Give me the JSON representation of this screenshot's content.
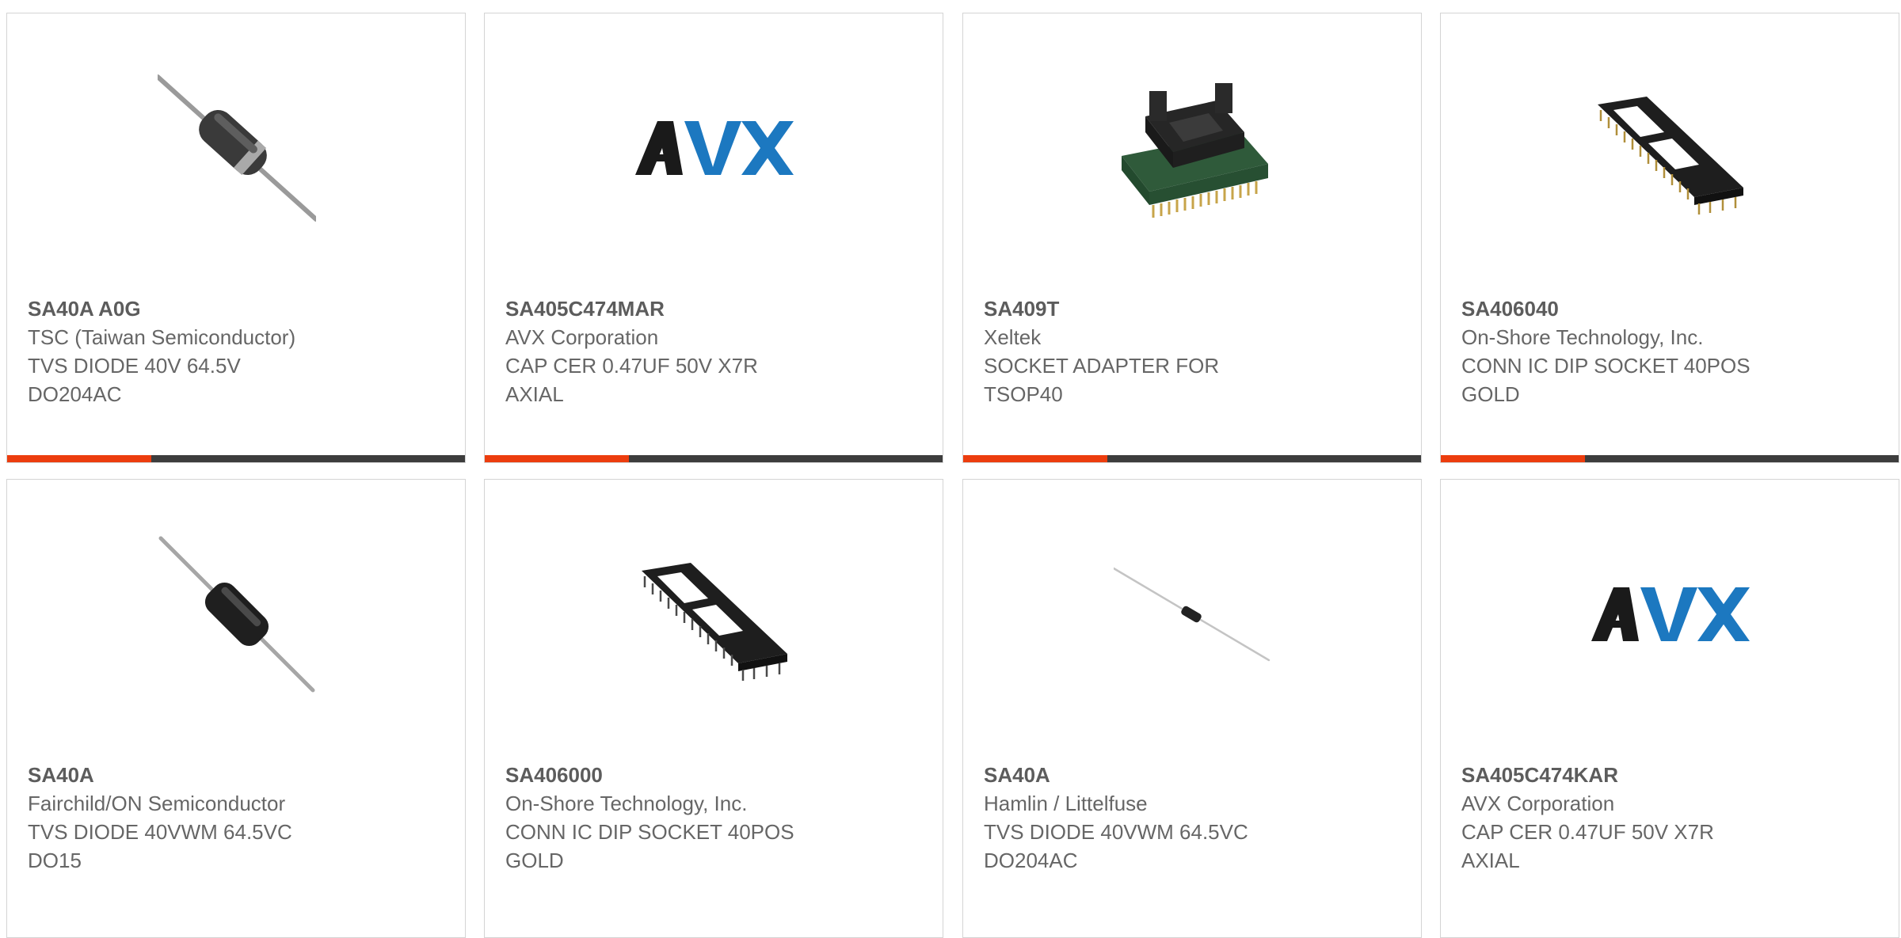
{
  "colors": {
    "accent": "#ec3d0e",
    "bar_dark": "#3d3d3d",
    "avx_blue": "#1c78c0",
    "avx_black": "#1a1a1a"
  },
  "products": [
    {
      "part_number": "SA40A A0G",
      "manufacturer": "TSC (Taiwan Semiconductor)",
      "desc_line1": "TVS DIODE 40V 64.5V",
      "desc_line2": "DO204AC",
      "image": "axial-diode-image"
    },
    {
      "part_number": "SA405C474MAR",
      "manufacturer": "AVX Corporation",
      "desc_line1": "CAP CER 0.47UF 50V X7R",
      "desc_line2": "AXIAL",
      "image": "avx-logo"
    },
    {
      "part_number": "SA409T",
      "manufacturer": "Xeltek",
      "desc_line1": "SOCKET ADAPTER FOR",
      "desc_line2": "TSOP40",
      "image": "socket-adapter-image"
    },
    {
      "part_number": "SA406040",
      "manufacturer": "On-Shore Technology, Inc.",
      "desc_line1": "CONN IC DIP SOCKET 40POS",
      "desc_line2": "GOLD",
      "image": "dip-socket-image"
    },
    {
      "part_number": "SA40A",
      "manufacturer": "Fairchild/ON Semiconductor",
      "desc_line1": "TVS DIODE 40VWM 64.5VC",
      "desc_line2": "DO15",
      "image": "axial-diode-image"
    },
    {
      "part_number": "SA406000",
      "manufacturer": "On-Shore Technology, Inc.",
      "desc_line1": "CONN IC DIP SOCKET 40POS",
      "desc_line2": "GOLD",
      "image": "dip-socket-image"
    },
    {
      "part_number": "SA40A",
      "manufacturer": "Hamlin / Littelfuse",
      "desc_line1": "TVS DIODE 40VWM 64.5VC",
      "desc_line2": "DO204AC",
      "image": "small-diode-image"
    },
    {
      "part_number": "SA405C474KAR",
      "manufacturer": "AVX Corporation",
      "desc_line1": "CAP CER 0.47UF 50V X7R",
      "desc_line2": "AXIAL",
      "image": "avx-logo"
    }
  ]
}
